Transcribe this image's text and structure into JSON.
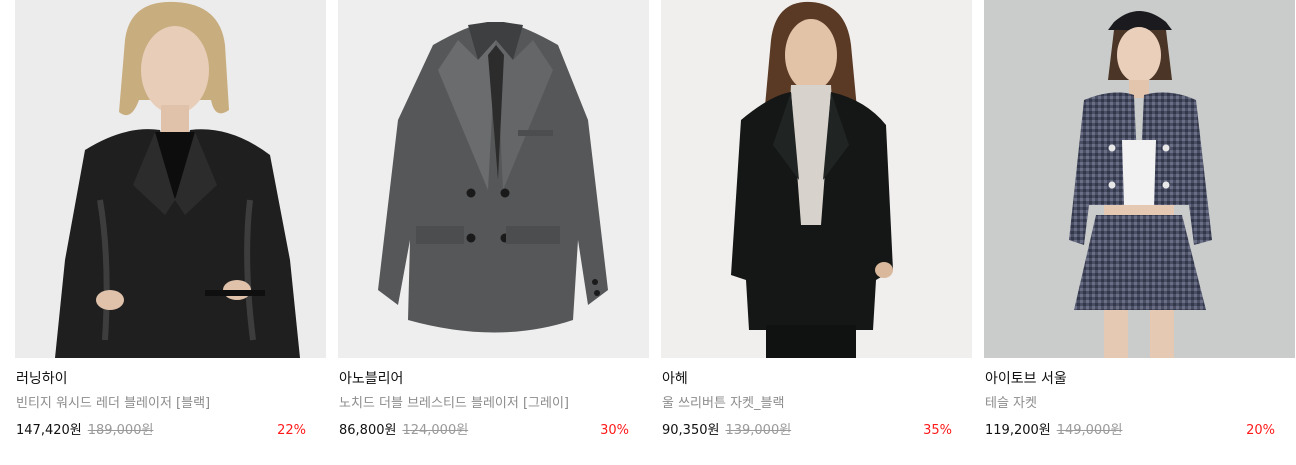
{
  "products": [
    {
      "brand": "러닝하이",
      "name": "빈티지 워시드 레더 블레이저 [블랙]",
      "price": "147,420원",
      "original_price": "189,000원",
      "discount": "22%",
      "image": "model-black-leather-jacket",
      "bg": "#ececec"
    },
    {
      "brand": "아노블리어",
      "name": "노치드 더블 브레스티드 블레이저 [그레이]",
      "price": "86,800원",
      "original_price": "124,000원",
      "discount": "30%",
      "image": "gray-double-breasted-blazer",
      "bg": "#eeeeee"
    },
    {
      "brand": "아헤",
      "name": "울 쓰리버튼 자켓_블랙",
      "price": "90,350원",
      "original_price": "139,000원",
      "discount": "35%",
      "image": "model-black-wool-jacket",
      "bg": "#f0efed"
    },
    {
      "brand": "아이토브 서울",
      "name": "테슬 자켓",
      "price": "119,200원",
      "original_price": "149,000원",
      "discount": "20%",
      "image": "model-tweed-jacket-skirt",
      "bg": "#c9ccca"
    }
  ],
  "colors": {
    "discount": "#ff1a1a",
    "muted_text": "#8c8c8c",
    "text": "#111111"
  }
}
